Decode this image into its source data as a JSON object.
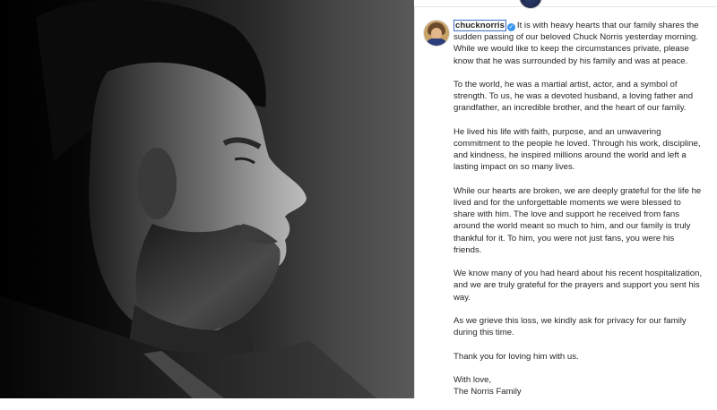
{
  "post": {
    "username": "chucknorris",
    "verified_icon": "verified-badge-icon",
    "caption_paragraphs": [
      "It is with heavy hearts that our family shares the sudden passing of our beloved Chuck Norris yesterday morning. While we would like to keep the circumstances private, please know that he was surrounded by his family and was at peace.",
      "To the world, he was a martial artist, actor, and a symbol of strength. To us, he was a devoted husband, a loving father and grandfather, an incredible brother, and the heart of our family.",
      "He lived his life with faith, purpose, and an unwavering commitment to the people he loved. Through his work, discipline, and kindness, he inspired millions around the world and left a lasting impact on so many lives.",
      "While our hearts are broken, we are deeply grateful for the life he lived and for the unforgettable moments we were blessed to share with him. The love and support he received from fans around the world meant so much to him, and our family is truly thankful for it. To him, you were not just fans, you were his friends.",
      "We know many of you had heard about his recent hospitalization, and we are truly grateful for the prayers and support you sent his way.",
      "As we grieve this loss, we kindly ask for privacy for our family during this time.",
      "Thank you for loving him with us.",
      "With love,\nThe Norris Family"
    ]
  },
  "colors": {
    "verified_blue": "#3897f0",
    "text": "#262626",
    "highlight_border": "#3b6cc4"
  }
}
